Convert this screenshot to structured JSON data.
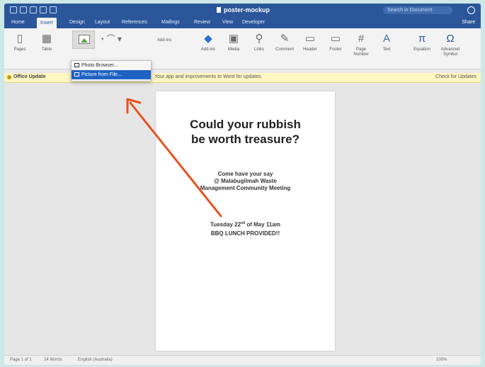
{
  "window": {
    "doc_title": "poster-mockup",
    "search_placeholder": "Search in Document",
    "share_label": "Share"
  },
  "tabs": [
    "Home",
    "Insert",
    "Design",
    "Layout",
    "References",
    "Mailings",
    "Review",
    "View",
    "Developer"
  ],
  "ribbon": {
    "page_label": "Pages",
    "table_label": "Table",
    "addins_label": "Add-ins",
    "buttons": [
      "Add-ins",
      "Media",
      "Links",
      "Comment",
      "Header",
      "Footer",
      "Page Number",
      "Text",
      "Equation",
      "Advanced Symbol"
    ]
  },
  "pictures_menu": {
    "items": [
      "Photo Browser...",
      "Picture from File..."
    ]
  },
  "infobar": {
    "title": "Office Update",
    "message": "Your app and improvements to Word for updates.",
    "button": "Check for Updates"
  },
  "document": {
    "headline_line1": "Could your rubbish",
    "headline_line2": "be worth treasure?",
    "sub_line1": "Come have your say",
    "sub_line2": "@ Malabugilmah Waste",
    "sub_line3": "Management Community Meeting",
    "event_line1_pre": "Tuesday 22",
    "event_line1_sup": "nd",
    "event_line1_post": " of May 11am",
    "event_line2": "BBQ LUNCH PROVIDED!!"
  },
  "statusbar": {
    "page": "Page 1 of 1",
    "words": "24 Words",
    "language": "English (Australia)",
    "zoom": "100%"
  },
  "colors": {
    "word_blue": "#2b579a",
    "menu_highlight": "#1e63c4",
    "arrow": "#e8501e"
  }
}
